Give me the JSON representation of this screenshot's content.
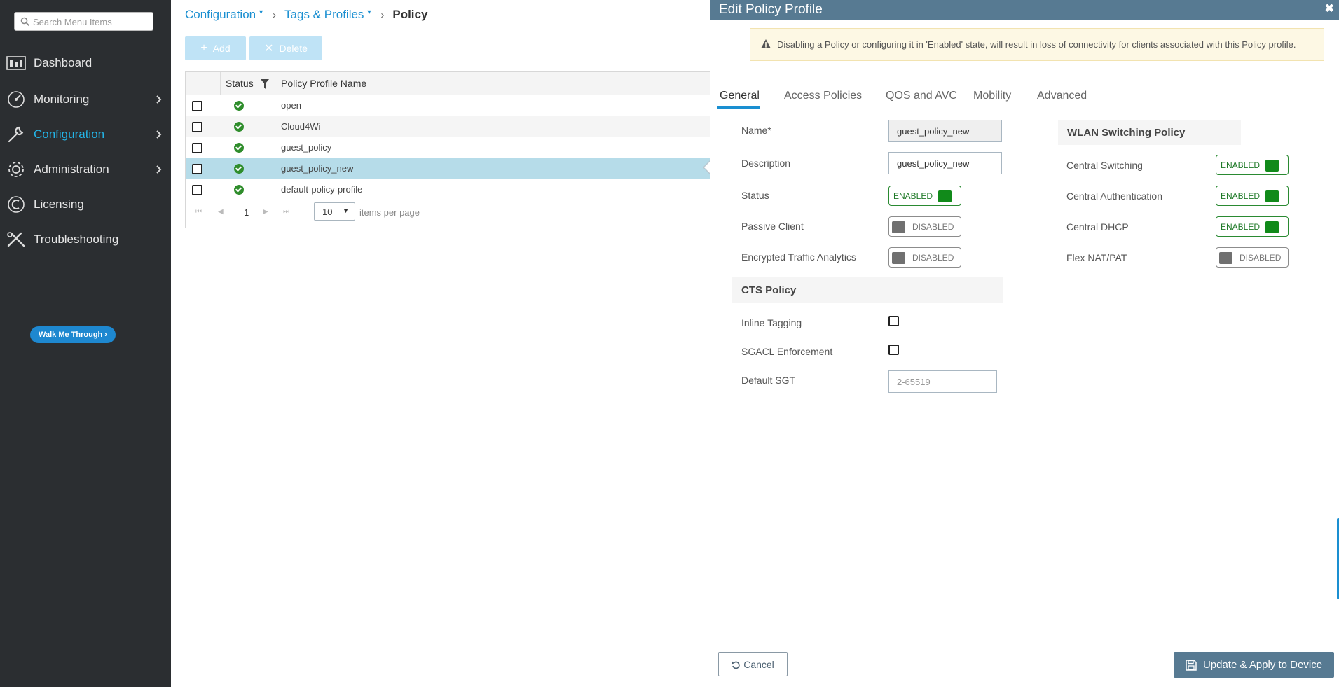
{
  "sidebar": {
    "search_placeholder": "Search Menu Items",
    "items": [
      {
        "label": "Dashboard",
        "icon": "dashboard-icon",
        "chevron": false
      },
      {
        "label": "Monitoring",
        "icon": "monitoring-icon",
        "chevron": true
      },
      {
        "label": "Configuration",
        "icon": "configuration-icon",
        "chevron": true,
        "active": true
      },
      {
        "label": "Administration",
        "icon": "administration-icon",
        "chevron": true
      },
      {
        "label": "Licensing",
        "icon": "licensing-icon",
        "chevron": false
      },
      {
        "label": "Troubleshooting",
        "icon": "troubleshooting-icon",
        "chevron": false
      }
    ],
    "walk_me_through": "Walk Me Through ›",
    "active_color": "#23b5e8"
  },
  "breadcrumb": {
    "configuration": "Configuration",
    "tags_profiles": "Tags & Profiles",
    "current": "Policy"
  },
  "toolbar": {
    "add_label": "Add",
    "delete_label": "Delete"
  },
  "grid": {
    "columns": [
      "Status",
      "Policy Profile Name"
    ],
    "rows": [
      {
        "name": "open",
        "status": "ok"
      },
      {
        "name": "Cloud4Wi",
        "status": "ok"
      },
      {
        "name": "guest_policy",
        "status": "ok"
      },
      {
        "name": "guest_policy_new",
        "status": "ok",
        "selected": true
      },
      {
        "name": "default-policy-profile",
        "status": "ok"
      }
    ],
    "pager": {
      "page": "1",
      "page_size": "10",
      "items_per_page_label": "items per page"
    }
  },
  "panel": {
    "title": "Edit Policy Profile",
    "close": "✖",
    "warning": "Disabling a Policy or configuring it in 'Enabled' state, will result in loss of connectivity for clients associated with this Policy profile.",
    "tabs": [
      "General",
      "Access Policies",
      "QOS and AVC",
      "Mobility",
      "Advanced"
    ],
    "active_tab": "General",
    "general": {
      "name_label": "Name*",
      "name_value": "guest_policy_new",
      "description_label": "Description",
      "description_value": "guest_policy_new",
      "status_label": "Status",
      "status_value": "ENABLED",
      "passive_client_label": "Passive Client",
      "passive_client_value": "DISABLED",
      "eta_label": "Encrypted Traffic Analytics",
      "eta_value": "DISABLED"
    },
    "cts": {
      "heading": "CTS Policy",
      "inline_tagging_label": "Inline Tagging",
      "sgacl_label": "SGACL Enforcement",
      "default_sgt_label": "Default SGT",
      "default_sgt_placeholder": "2-65519"
    },
    "wlan_switching": {
      "heading": "WLAN Switching Policy",
      "central_switching_label": "Central Switching",
      "central_switching_value": "ENABLED",
      "central_auth_label": "Central Authentication",
      "central_auth_value": "ENABLED",
      "central_dhcp_label": "Central DHCP",
      "central_dhcp_value": "ENABLED",
      "flex_nat_label": "Flex NAT/PAT",
      "flex_nat_value": "DISABLED"
    },
    "footer": {
      "cancel_label": "Cancel",
      "apply_label": "Update & Apply to Device"
    },
    "colors": {
      "header": "#577a92",
      "enabled": "#118a1a",
      "link": "#1a8fd1"
    }
  }
}
